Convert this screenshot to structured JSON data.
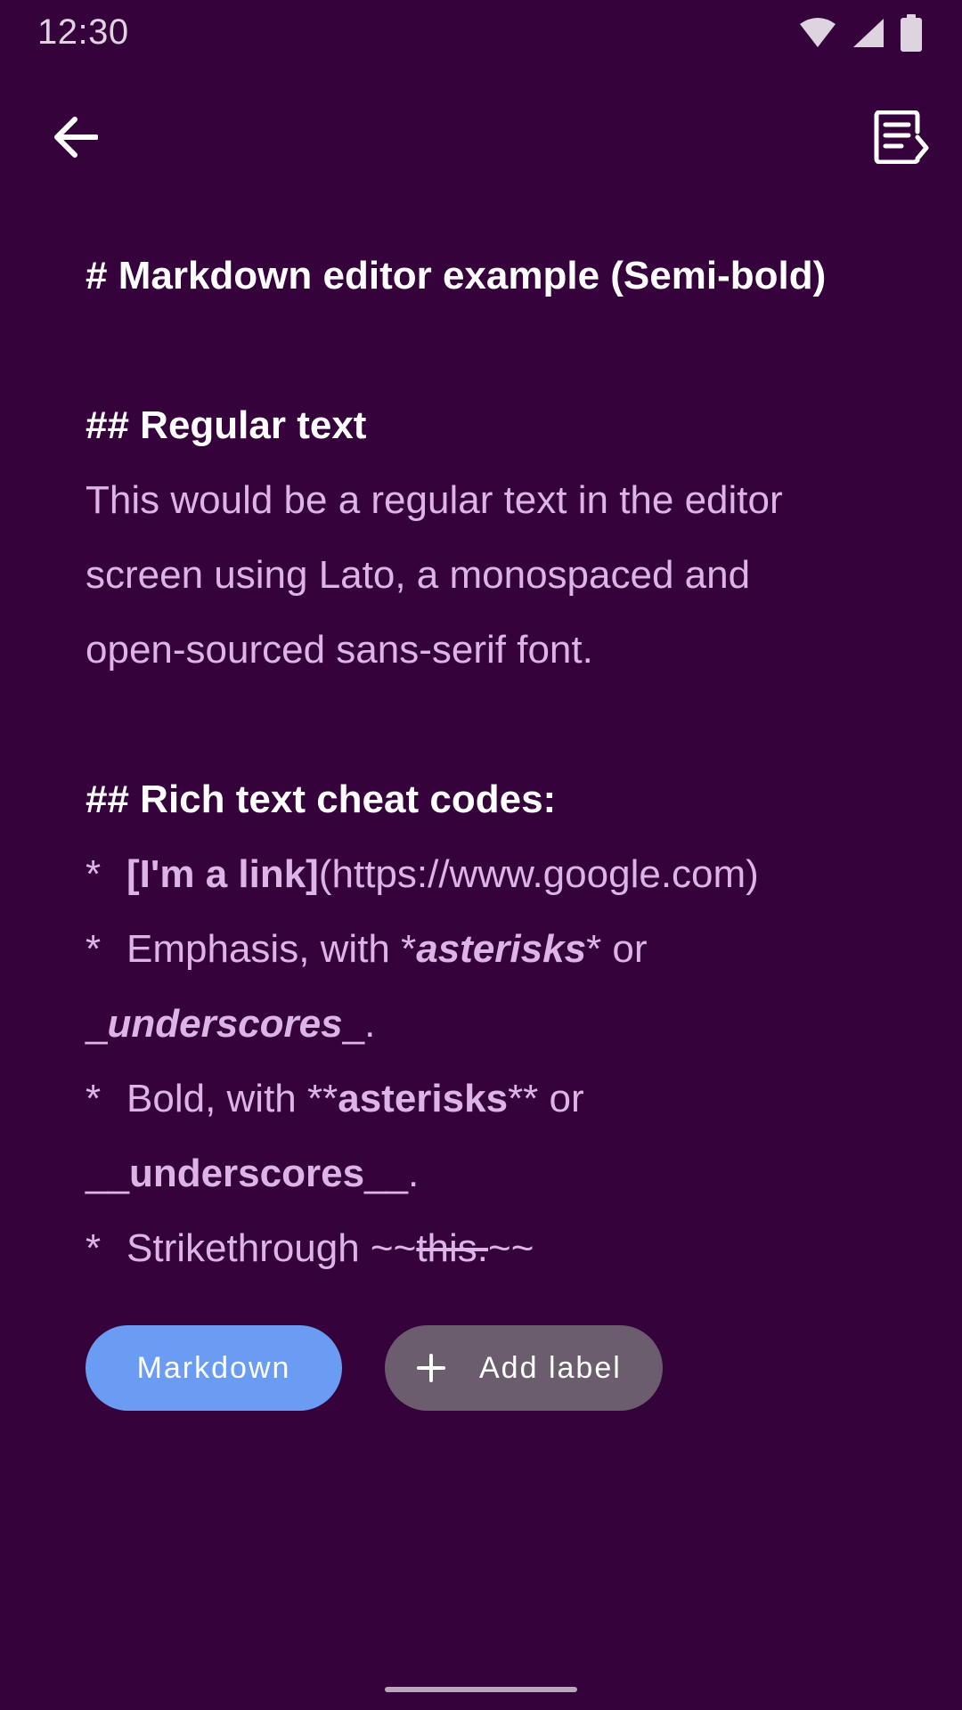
{
  "status_bar": {
    "time": "12:30",
    "icons": [
      "wifi-icon",
      "cellular-signal-icon",
      "battery-icon"
    ]
  },
  "app_bar": {
    "back_icon": "arrow-left-icon",
    "action_icon": "note-preview-icon"
  },
  "editor": {
    "line1": "# Markdown editor example (Semi-bold)",
    "line3": "## Regular text",
    "line4": "This would be a regular text in the editor",
    "line5": "screen using Lato, a monospaced and",
    "line6": "open-sourced sans-serif font.",
    "line8": "## Rich text cheat codes:",
    "line9": {
      "star": "*",
      "link": "[I'm a link]",
      "url": "(https://www.google.com)"
    },
    "line10": {
      "star": "*",
      "pre": "Emphasis, with *",
      "em": "asterisks",
      "post": "* or"
    },
    "line11": {
      "pre": "_",
      "em": "underscores",
      "post": "_."
    },
    "line12": {
      "star": "*",
      "pre": "Bold, with **",
      "strong": "asterisks",
      "post": "** or"
    },
    "line13": {
      "pre": "__",
      "strong": "underscores",
      "post": "__."
    },
    "line14": {
      "star": "*",
      "pre": "Strikethrough ~~",
      "strike": "this.",
      "post": "~~"
    }
  },
  "chips": {
    "markdown": "Markdown",
    "add_label": "Add label"
  },
  "colors": {
    "background": "#36023c",
    "body_text": "#dcb4e6",
    "heading_text": "#ffffff",
    "markdown_chip": "#6a9cf4",
    "add_label_chip": "#6b5d6d"
  }
}
